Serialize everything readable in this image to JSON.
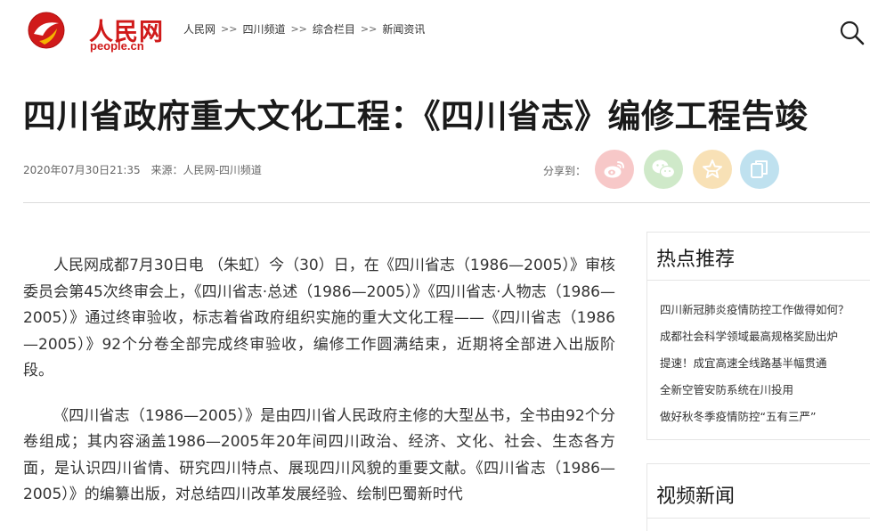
{
  "header": {
    "logo_text": "人民网",
    "logo_domain": "people.cn",
    "breadcrumb": [
      "人民网",
      "四川频道",
      "综合栏目",
      "新闻资讯"
    ],
    "breadcrumb_sep": ">>"
  },
  "article": {
    "title": "四川省政府重大文化工程：《四川省志》编修工程告竣",
    "date": "2020年07月30日21:35",
    "source": "来源：人民网-四川频道",
    "share_label": "分享到：",
    "paragraphs": [
      "人民网成都7月30日电 （朱虹）今（30）日，在《四川省志（1986—2005）》审核委员会第45次终审会上，《四川省志·总述（1986—2005）》《四川省志·人物志（1986—2005）》通过终审验收，标志着省政府组织实施的重大文化工程——《四川省志（1986—2005）》92个分卷全部完成终审验收，编修工作圆满结束，近期将全部进入出版阶段。",
      "《四川省志（1986—2005）》是由四川省人民政府主修的大型丛书，全书由92个分卷组成；其内容涵盖1986—2005年20年间四川政治、经济、文化、社会、生态各方面，是认识四川省情、研究四川特点、展现四川风貌的重要文献。《四川省志（1986—2005）》的编纂出版，对总结四川改革发展经验、绘制巴蜀新时代"
    ]
  },
  "sidebar": {
    "hot_title": "热点推荐",
    "hot_items": [
      "四川新冠肺炎疫情防控工作做得如何？",
      "成都社会科学领域最高规格奖励出炉",
      "提速！成宜高速全线路基半幅贯通",
      "全新空管安防系统在川投用",
      "做好秋冬季疫情防控“五有三严”"
    ],
    "video_title": "视频新闻"
  },
  "colors": {
    "brand_red": "#d01a1a",
    "weibo": "#f7c8c8",
    "wechat": "#cfe9c9",
    "favorite": "#f8e1b6",
    "copy": "#bfe1ef"
  },
  "icons": [
    "logo-icon",
    "search-icon",
    "weibo-icon",
    "wechat-icon",
    "star-icon",
    "copy-icon"
  ]
}
